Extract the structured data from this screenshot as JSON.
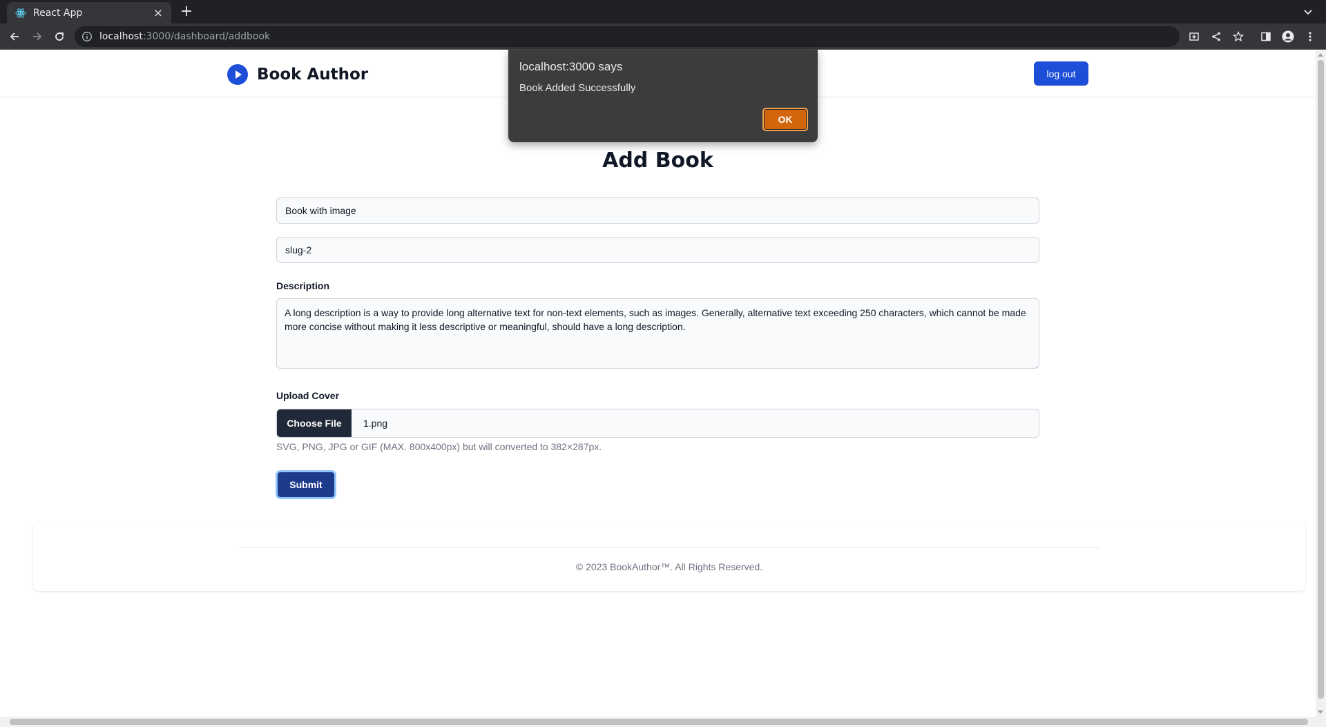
{
  "browser": {
    "tab_title": "React App",
    "url_host": "localhost",
    "url_rest": ":3000/dashboard/addbook",
    "new_tab_symbol": "+",
    "close_tab_symbol": "×"
  },
  "navbar": {
    "brand": "Book Author",
    "logout_label": "log out",
    "accent": "#1d4ed8"
  },
  "form": {
    "title": "Add Book",
    "book_title_value": "Book with image",
    "slug_value": "slug-2",
    "description_label": "Description",
    "description_value": "A long description is a way to provide long alternative text for non-text elements, such as images. Generally, alternative text exceeding 250 characters, which cannot be made more concise without making it less descriptive or meaningful, should have a long description.",
    "upload_label": "Upload Cover",
    "choose_file_label": "Choose File",
    "file_name": "1.png",
    "help_text": "SVG, PNG, JPG or GIF (MAX. 800x400px) but will converted to 382×287px.",
    "submit_label": "Submit"
  },
  "footer": {
    "text": "© 2023 BookAuthor™. All Rights Reserved."
  },
  "alert": {
    "origin": "localhost:3000 says",
    "message": "Book Added Successfully",
    "ok_label": "OK",
    "accent": "#d3650c"
  }
}
